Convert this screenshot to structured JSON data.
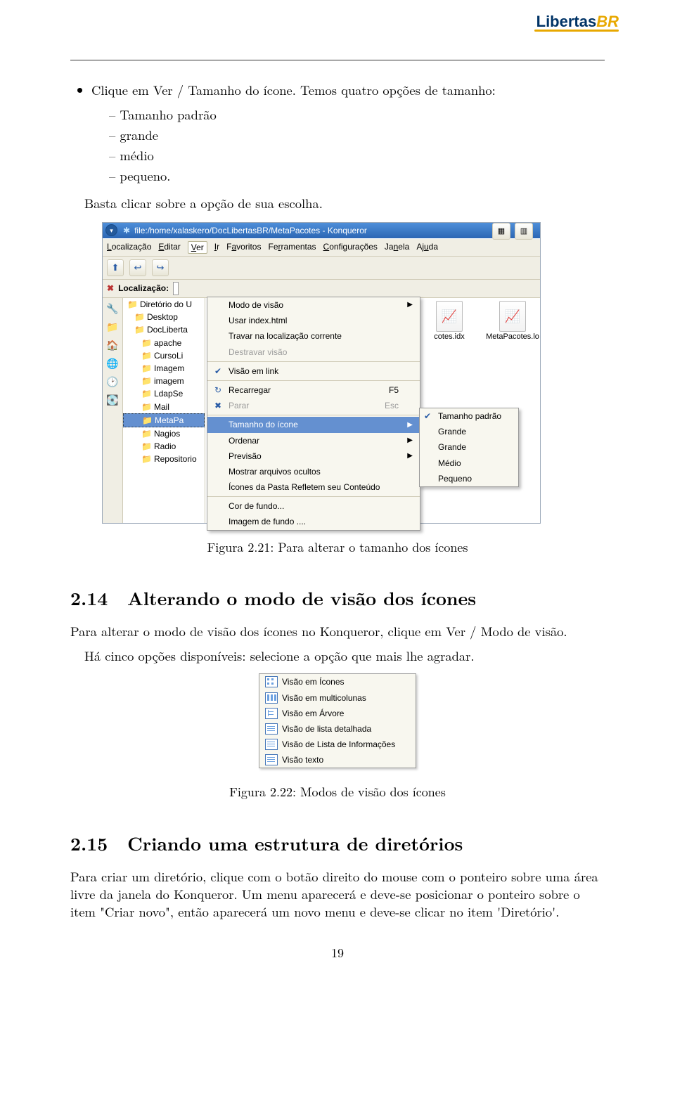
{
  "logo": {
    "part1": "Libertas",
    "part2": "BR"
  },
  "bullet1": "Clique em Ver / Tamanho do ícone. Temos quatro opções de tamanho:",
  "size_options": [
    "Tamanho padrão",
    "grande",
    "médio",
    "pequeno."
  ],
  "after_options": "Basta clicar sobre a opção de sua escolha.",
  "shot1": {
    "title": "file:/home/xalaskero/DocLibertasBR/MetaPacotes - Konqueror",
    "menu": {
      "loc": "Localização",
      "edit": "Editar",
      "ver": "Ver",
      "ir": "Ir",
      "fav": "Favoritos",
      "ferr": "Ferramentas",
      "conf": "Configurações",
      "jan": "Janela",
      "ajuda": "Ajuda"
    },
    "loc_label": "Localização:",
    "tree": [
      {
        "ind": 0,
        "label": "Diretório do U"
      },
      {
        "ind": 1,
        "label": "Desktop"
      },
      {
        "ind": 1,
        "label": "DocLiberta"
      },
      {
        "ind": 2,
        "label": "apache"
      },
      {
        "ind": 2,
        "label": "CursoLi"
      },
      {
        "ind": 2,
        "label": "Imagem"
      },
      {
        "ind": 2,
        "label": "imagem"
      },
      {
        "ind": 2,
        "label": "LdapSe"
      },
      {
        "ind": 2,
        "label": "Mail"
      },
      {
        "ind": 2,
        "label": "MetaPa",
        "hl": true
      },
      {
        "ind": 2,
        "label": "Nagios"
      },
      {
        "ind": 2,
        "label": "Radio"
      },
      {
        "ind": 2,
        "label": "Repositorio"
      }
    ],
    "dropdown": [
      {
        "t": "Modo de visão",
        "arrow": true
      },
      {
        "t": "Usar index.html"
      },
      {
        "t": "Travar na localização corrente"
      },
      {
        "t": "Destravar visão",
        "dis": true
      },
      {
        "sep": true
      },
      {
        "t": "Visão em link",
        "chk": true
      },
      {
        "sep": true
      },
      {
        "t": "Recarregar",
        "sc": "F5",
        "icon": "↻"
      },
      {
        "t": "Parar",
        "sc": "Esc",
        "dis": true,
        "icon": "✖"
      },
      {
        "sep": true
      },
      {
        "t": "Tamanho do ícone",
        "arrow": true,
        "hl": true
      },
      {
        "t": "Ordenar",
        "arrow": true
      },
      {
        "t": "Previsão",
        "arrow": true
      },
      {
        "t": "Mostrar arquivos ocultos"
      },
      {
        "t": "Ícones da Pasta Refletem seu Conteúdo"
      },
      {
        "sep": true
      },
      {
        "t": "Cor de fundo..."
      },
      {
        "t": "Imagem de fundo ...."
      }
    ],
    "submenu": [
      {
        "t": "Tamanho padrão",
        "chk": true
      },
      {
        "t": "Grande"
      },
      {
        "t": "Grande"
      },
      {
        "t": "Médio"
      },
      {
        "t": "Pequeno"
      }
    ],
    "files": [
      {
        "name": "cotes.idx",
        "icon": "📈"
      },
      {
        "name": "MetaPacotes.lo",
        "icon": "📈"
      }
    ]
  },
  "caption1": "Figura 2.21: Para alterar o tamanho dos ícones",
  "sec214": {
    "num": "2.14",
    "title": "Alterando o modo de visão dos ícones"
  },
  "p214a": "Para alterar o modo de visão dos ícones no Konqueror, clique em Ver / Modo de visão.",
  "p214b": "Há cinco opções disponíveis: selecione a opção que mais lhe agradar.",
  "shot2": [
    "Visão em Ícones",
    "Visão em multicolunas",
    "Visão em Árvore",
    "Visão de lista detalhada",
    "Visão de Lista de Informações",
    "Visão texto"
  ],
  "caption2": "Figura 2.22: Modos de visão dos ícones",
  "sec215": {
    "num": "2.15",
    "title": "Criando uma estrutura de diretórios"
  },
  "p215": "Para criar um diretório, clique com o botão direito do mouse com o ponteiro sobre uma área livre da janela do Konqueror. Um menu aparecerá e deve-se posicionar o ponteiro sobre o item \"Criar novo\", então aparecerá um novo menu e deve-se clicar no item 'Diretório'.",
  "pagenum": "19"
}
